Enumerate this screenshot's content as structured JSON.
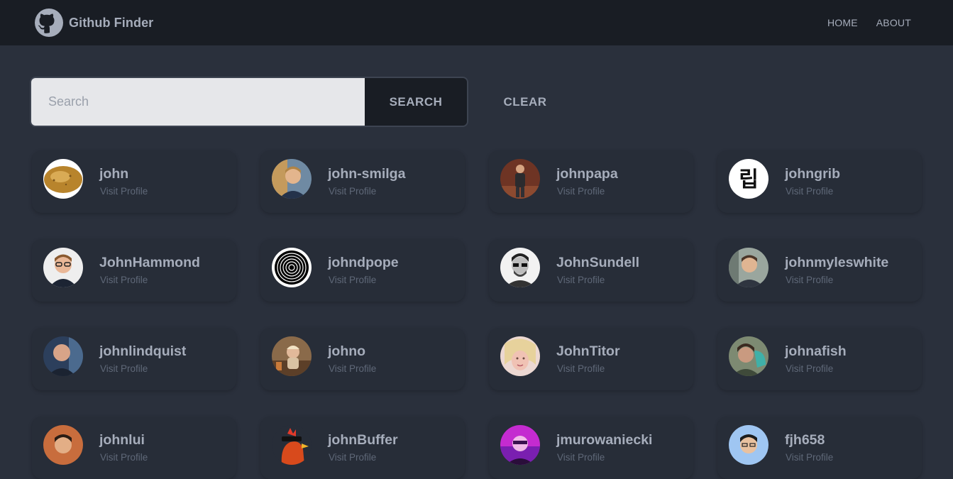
{
  "app": {
    "title": "Github Finder",
    "logo_icon": "github-octocat-icon"
  },
  "nav": {
    "home_label": "HOME",
    "about_label": "ABOUT"
  },
  "search": {
    "placeholder": "Search",
    "value": "",
    "search_label": "SEARCH",
    "clear_label": "CLEAR"
  },
  "colors": {
    "background": "#2a303c",
    "navbar": "#191d24",
    "card": "#272d38",
    "text": "#a6adbb",
    "muted_text": "#5f6878",
    "input_bg": "#e6e7ea"
  },
  "users": [
    {
      "login": "john",
      "link_label": "Visit Profile",
      "avatar": "potato-photo"
    },
    {
      "login": "john-smilga",
      "link_label": "Visit Profile",
      "avatar": "person-photo"
    },
    {
      "login": "johnpapa",
      "link_label": "Visit Profile",
      "avatar": "person-photo"
    },
    {
      "login": "johngrib",
      "link_label": "Visit Profile",
      "avatar": "hangul-rib-logo"
    },
    {
      "login": "JohnHammond",
      "link_label": "Visit Profile",
      "avatar": "person-photo"
    },
    {
      "login": "johndpope",
      "link_label": "Visit Profile",
      "avatar": "spiral-logo"
    },
    {
      "login": "JohnSundell",
      "link_label": "Visit Profile",
      "avatar": "person-photo"
    },
    {
      "login": "johnmyleswhite",
      "link_label": "Visit Profile",
      "avatar": "person-photo"
    },
    {
      "login": "johnlindquist",
      "link_label": "Visit Profile",
      "avatar": "person-photo"
    },
    {
      "login": "johno",
      "link_label": "Visit Profile",
      "avatar": "person-photo"
    },
    {
      "login": "JohnTitor",
      "link_label": "Visit Profile",
      "avatar": "person-photo"
    },
    {
      "login": "johnafish",
      "link_label": "Visit Profile",
      "avatar": "person-photo"
    },
    {
      "login": "johnlui",
      "link_label": "Visit Profile",
      "avatar": "person-photo"
    },
    {
      "login": "johnBuffer",
      "link_label": "Visit Profile",
      "avatar": "rooster-with-sunglasses"
    },
    {
      "login": "jmurowaniecki",
      "link_label": "Visit Profile",
      "avatar": "person-photo"
    },
    {
      "login": "fjh658",
      "link_label": "Visit Profile",
      "avatar": "person-photo"
    }
  ]
}
